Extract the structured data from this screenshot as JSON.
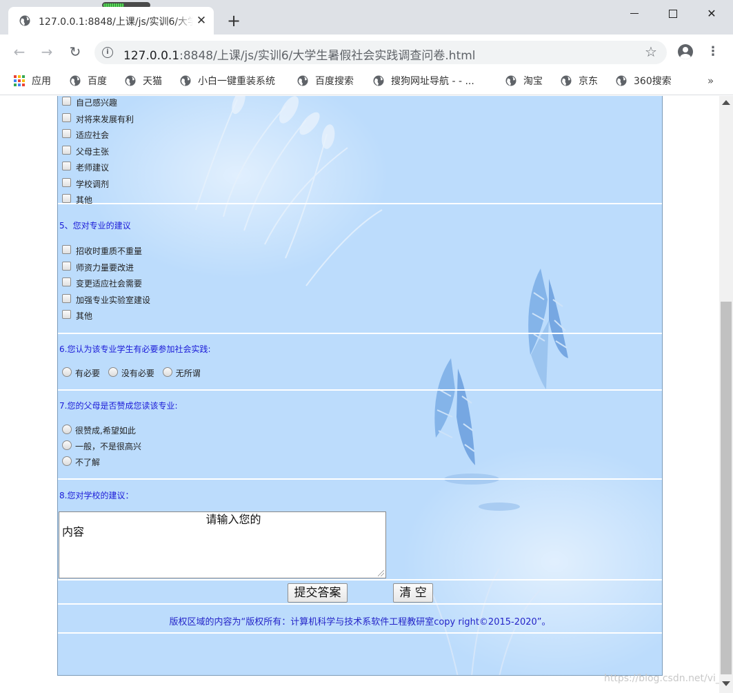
{
  "browser": {
    "tab_title": "127.0.0.1:8848/上课/js/实训6/大学生暑假社会实践调查问卷.html",
    "close_tab_glyph": "✕",
    "new_tab_glyph": "+",
    "window_close_glyph": "✕",
    "url_host": "127.0.0.1",
    "url_path": ":8848/上课/js/实训6/大学生暑假社会实践调查问卷.html",
    "info_glyph": "i",
    "star_glyph": "☆",
    "back_glyph": "←",
    "forward_glyph": "→",
    "reload_glyph": "↻",
    "menu_glyph": "⋮"
  },
  "bookmarks": {
    "items": [
      "应用",
      "百度",
      "天猫",
      "小白一键重装系统",
      "百度搜索",
      "搜狗网址导航 - - ...",
      "淘宝",
      "京东",
      "360搜索"
    ],
    "more": "»",
    "apps_colors": [
      "#ea4335",
      "#fbbc04",
      "#34a853",
      "#4285f4",
      "#ea4335",
      "#fbbc04",
      "#34a853",
      "#4285f4",
      "#ea4335"
    ]
  },
  "form": {
    "q4_options": [
      "自己感兴趣",
      "对将来发展有利",
      "适应社会",
      "父母主张",
      "老师建议",
      "学校调剂",
      "其他"
    ],
    "q5": {
      "title": "5、您对专业的建议",
      "options": [
        "招收时重质不重量",
        "师资力量要改进",
        "变更适应社会需要",
        "加强专业实验室建设",
        "其他"
      ]
    },
    "q6": {
      "title": "6.您认为该专业学生有必要参加社会实践:",
      "options": [
        "有必要",
        "没有必要",
        "无所谓"
      ]
    },
    "q7": {
      "title": "7.您的父母是否赞成您读该专业:",
      "options": [
        "很赞成,希望如此",
        "一般，不是很高兴",
        "不了解"
      ]
    },
    "q8": {
      "title": "8.您对学校的建议：",
      "textarea_value": "                                         请输入您的\n内容"
    },
    "submit_label": "提交答案",
    "clear_label": "清 空",
    "footer": "版权区域的内容为“版权所有：计算机科学与技术系软件工程教研室copy right©2015-2020”。"
  },
  "watermark": "https://blog.csdn.net/vi_o"
}
